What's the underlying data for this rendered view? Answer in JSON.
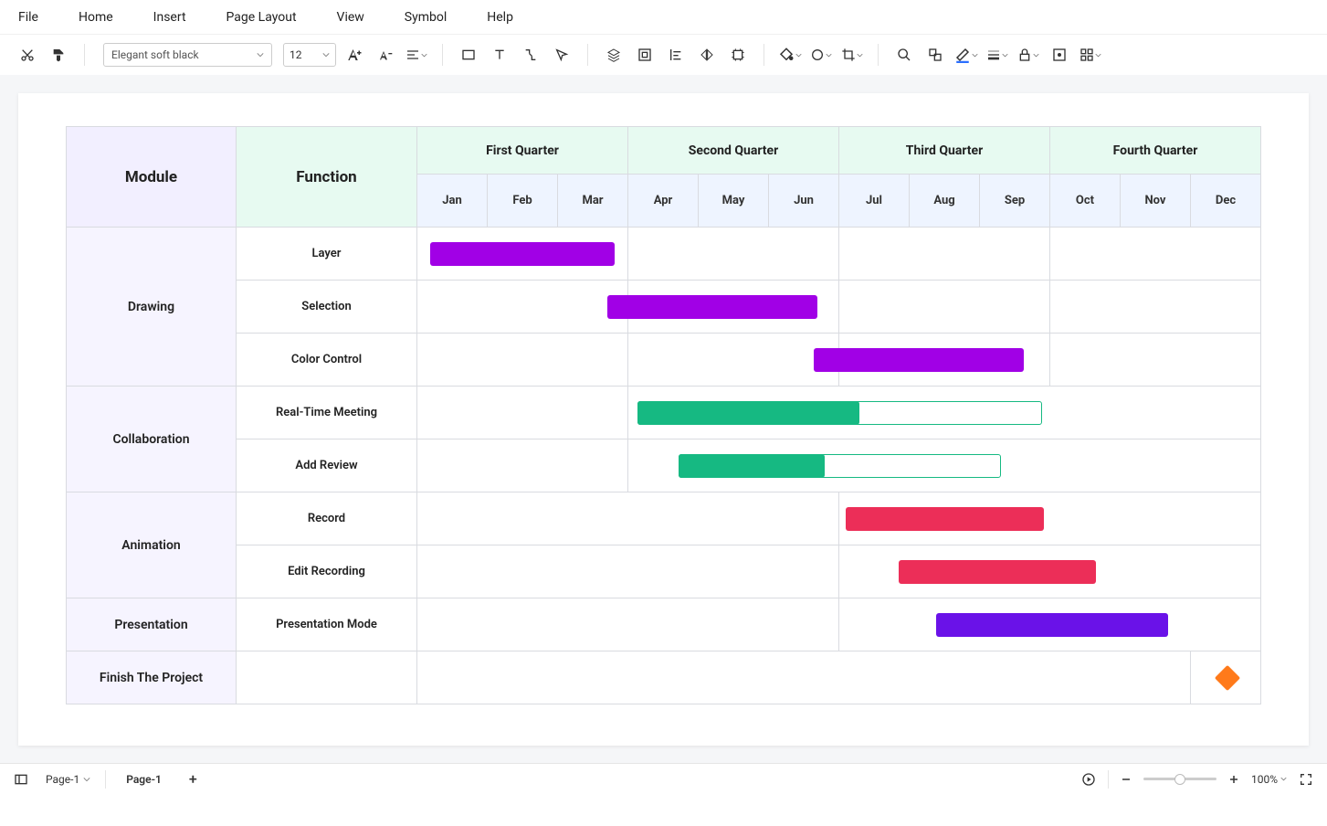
{
  "menubar": {
    "items": [
      "File",
      "Home",
      "Insert",
      "Page Layout",
      "View",
      "Symbol",
      "Help"
    ]
  },
  "toolbar": {
    "font_name": "Elegant soft black",
    "font_size": "12"
  },
  "gantt": {
    "headers": {
      "module": "Module",
      "function": "Function",
      "quarters": [
        "First Quarter",
        "Second Quarter",
        "Third Quarter",
        "Fourth Quarter"
      ],
      "months": [
        "Jan",
        "Feb",
        "Mar",
        "Apr",
        "May",
        "Jun",
        "Jul",
        "Aug",
        "Sep",
        "Oct",
        "Nov",
        "Dec"
      ]
    },
    "rows": [
      {
        "module": "Drawing",
        "function": "Layer"
      },
      {
        "module": "",
        "function": "Selection"
      },
      {
        "module": "",
        "function": "Color Control"
      },
      {
        "module": "Collaboration",
        "function": "Real-Time Meeting"
      },
      {
        "module": "",
        "function": "Add Review"
      },
      {
        "module": "Animation",
        "function": "Record"
      },
      {
        "module": "",
        "function": "Edit Recording"
      },
      {
        "module": "Presentation",
        "function": "Presentation Mode"
      },
      {
        "module": "Finish The Project",
        "function": ""
      }
    ]
  },
  "chart_data": {
    "type": "bar",
    "title": "",
    "xlabel": "",
    "ylabel": "",
    "categories": [
      "Jan",
      "Feb",
      "Mar",
      "Apr",
      "May",
      "Jun",
      "Jul",
      "Aug",
      "Sep",
      "Oct",
      "Nov",
      "Dec"
    ],
    "tasks": [
      {
        "module": "Drawing",
        "name": "Layer",
        "start": "Jan",
        "end": "Mar",
        "progress": 1.0,
        "color": "#a100e6"
      },
      {
        "module": "Drawing",
        "name": "Selection",
        "start": "Mar",
        "end": "Jun",
        "progress": 1.0,
        "color": "#a100e6",
        "depends_on": "Layer"
      },
      {
        "module": "Drawing",
        "name": "Color Control",
        "start": "Jun",
        "end": "Sep",
        "progress": 1.0,
        "color": "#a100e6",
        "depends_on": "Selection"
      },
      {
        "module": "Collaboration",
        "name": "Real-Time Meeting",
        "start": "Apr",
        "end": "Oct",
        "progress": 0.55,
        "color": "#16b982"
      },
      {
        "module": "Collaboration",
        "name": "Add Review",
        "start": "May",
        "end": "Oct",
        "progress": 0.45,
        "color": "#16b982"
      },
      {
        "module": "Animation",
        "name": "Record",
        "start": "Jul",
        "end": "Oct",
        "progress": 1.0,
        "color": "#ec2e58"
      },
      {
        "module": "Animation",
        "name": "Edit Recording",
        "start": "Aug",
        "end": "Nov",
        "progress": 1.0,
        "color": "#ec2e58"
      },
      {
        "module": "Presentation",
        "name": "Presentation Mode",
        "start": "Sep",
        "end": "Dec",
        "progress": 1.0,
        "color": "#6a12e8"
      },
      {
        "module": "",
        "name": "Finish The Project",
        "milestone": true,
        "at": "Dec",
        "color": "#ff7a1a"
      }
    ]
  },
  "footer": {
    "page_select": "Page-1",
    "active_tab": "Page-1",
    "zoom": "100%"
  }
}
